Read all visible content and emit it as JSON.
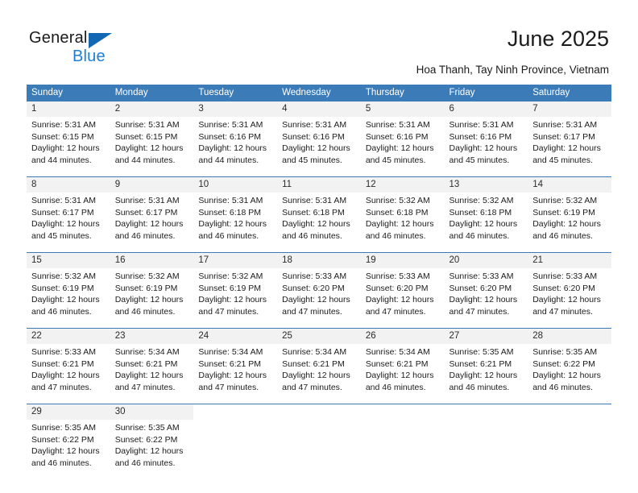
{
  "brand": {
    "name_part1": "General",
    "name_part2": "Blue",
    "color_dark": "#1b1b1b",
    "color_blue": "#1c7fd4",
    "triangle_color": "#1268b3"
  },
  "header": {
    "title": "June 2025",
    "subtitle": "Hoa Thanh, Tay Ninh Province, Vietnam"
  },
  "theme": {
    "header_row_bg": "#3b7cb8",
    "header_row_text": "#ffffff",
    "daynum_bg": "#f2f2f2",
    "separator_color": "#3b7cb8",
    "body_text": "#1b1b1b"
  },
  "calendar": {
    "weekday_headers": [
      "Sunday",
      "Monday",
      "Tuesday",
      "Wednesday",
      "Thursday",
      "Friday",
      "Saturday"
    ],
    "weeks": [
      {
        "days": [
          {
            "num": "1",
            "sunrise": "Sunrise: 5:31 AM",
            "sunset": "Sunset: 6:15 PM",
            "daylight": "Daylight: 12 hours and 44 minutes."
          },
          {
            "num": "2",
            "sunrise": "Sunrise: 5:31 AM",
            "sunset": "Sunset: 6:15 PM",
            "daylight": "Daylight: 12 hours and 44 minutes."
          },
          {
            "num": "3",
            "sunrise": "Sunrise: 5:31 AM",
            "sunset": "Sunset: 6:16 PM",
            "daylight": "Daylight: 12 hours and 44 minutes."
          },
          {
            "num": "4",
            "sunrise": "Sunrise: 5:31 AM",
            "sunset": "Sunset: 6:16 PM",
            "daylight": "Daylight: 12 hours and 45 minutes."
          },
          {
            "num": "5",
            "sunrise": "Sunrise: 5:31 AM",
            "sunset": "Sunset: 6:16 PM",
            "daylight": "Daylight: 12 hours and 45 minutes."
          },
          {
            "num": "6",
            "sunrise": "Sunrise: 5:31 AM",
            "sunset": "Sunset: 6:16 PM",
            "daylight": "Daylight: 12 hours and 45 minutes."
          },
          {
            "num": "7",
            "sunrise": "Sunrise: 5:31 AM",
            "sunset": "Sunset: 6:17 PM",
            "daylight": "Daylight: 12 hours and 45 minutes."
          }
        ]
      },
      {
        "days": [
          {
            "num": "8",
            "sunrise": "Sunrise: 5:31 AM",
            "sunset": "Sunset: 6:17 PM",
            "daylight": "Daylight: 12 hours and 45 minutes."
          },
          {
            "num": "9",
            "sunrise": "Sunrise: 5:31 AM",
            "sunset": "Sunset: 6:17 PM",
            "daylight": "Daylight: 12 hours and 46 minutes."
          },
          {
            "num": "10",
            "sunrise": "Sunrise: 5:31 AM",
            "sunset": "Sunset: 6:18 PM",
            "daylight": "Daylight: 12 hours and 46 minutes."
          },
          {
            "num": "11",
            "sunrise": "Sunrise: 5:31 AM",
            "sunset": "Sunset: 6:18 PM",
            "daylight": "Daylight: 12 hours and 46 minutes."
          },
          {
            "num": "12",
            "sunrise": "Sunrise: 5:32 AM",
            "sunset": "Sunset: 6:18 PM",
            "daylight": "Daylight: 12 hours and 46 minutes."
          },
          {
            "num": "13",
            "sunrise": "Sunrise: 5:32 AM",
            "sunset": "Sunset: 6:18 PM",
            "daylight": "Daylight: 12 hours and 46 minutes."
          },
          {
            "num": "14",
            "sunrise": "Sunrise: 5:32 AM",
            "sunset": "Sunset: 6:19 PM",
            "daylight": "Daylight: 12 hours and 46 minutes."
          }
        ]
      },
      {
        "days": [
          {
            "num": "15",
            "sunrise": "Sunrise: 5:32 AM",
            "sunset": "Sunset: 6:19 PM",
            "daylight": "Daylight: 12 hours and 46 minutes."
          },
          {
            "num": "16",
            "sunrise": "Sunrise: 5:32 AM",
            "sunset": "Sunset: 6:19 PM",
            "daylight": "Daylight: 12 hours and 46 minutes."
          },
          {
            "num": "17",
            "sunrise": "Sunrise: 5:32 AM",
            "sunset": "Sunset: 6:19 PM",
            "daylight": "Daylight: 12 hours and 47 minutes."
          },
          {
            "num": "18",
            "sunrise": "Sunrise: 5:33 AM",
            "sunset": "Sunset: 6:20 PM",
            "daylight": "Daylight: 12 hours and 47 minutes."
          },
          {
            "num": "19",
            "sunrise": "Sunrise: 5:33 AM",
            "sunset": "Sunset: 6:20 PM",
            "daylight": "Daylight: 12 hours and 47 minutes."
          },
          {
            "num": "20",
            "sunrise": "Sunrise: 5:33 AM",
            "sunset": "Sunset: 6:20 PM",
            "daylight": "Daylight: 12 hours and 47 minutes."
          },
          {
            "num": "21",
            "sunrise": "Sunrise: 5:33 AM",
            "sunset": "Sunset: 6:20 PM",
            "daylight": "Daylight: 12 hours and 47 minutes."
          }
        ]
      },
      {
        "days": [
          {
            "num": "22",
            "sunrise": "Sunrise: 5:33 AM",
            "sunset": "Sunset: 6:21 PM",
            "daylight": "Daylight: 12 hours and 47 minutes."
          },
          {
            "num": "23",
            "sunrise": "Sunrise: 5:34 AM",
            "sunset": "Sunset: 6:21 PM",
            "daylight": "Daylight: 12 hours and 47 minutes."
          },
          {
            "num": "24",
            "sunrise": "Sunrise: 5:34 AM",
            "sunset": "Sunset: 6:21 PM",
            "daylight": "Daylight: 12 hours and 47 minutes."
          },
          {
            "num": "25",
            "sunrise": "Sunrise: 5:34 AM",
            "sunset": "Sunset: 6:21 PM",
            "daylight": "Daylight: 12 hours and 47 minutes."
          },
          {
            "num": "26",
            "sunrise": "Sunrise: 5:34 AM",
            "sunset": "Sunset: 6:21 PM",
            "daylight": "Daylight: 12 hours and 46 minutes."
          },
          {
            "num": "27",
            "sunrise": "Sunrise: 5:35 AM",
            "sunset": "Sunset: 6:21 PM",
            "daylight": "Daylight: 12 hours and 46 minutes."
          },
          {
            "num": "28",
            "sunrise": "Sunrise: 5:35 AM",
            "sunset": "Sunset: 6:22 PM",
            "daylight": "Daylight: 12 hours and 46 minutes."
          }
        ]
      },
      {
        "days": [
          {
            "num": "29",
            "sunrise": "Sunrise: 5:35 AM",
            "sunset": "Sunset: 6:22 PM",
            "daylight": "Daylight: 12 hours and 46 minutes."
          },
          {
            "num": "30",
            "sunrise": "Sunrise: 5:35 AM",
            "sunset": "Sunset: 6:22 PM",
            "daylight": "Daylight: 12 hours and 46 minutes."
          },
          {
            "num": "",
            "sunrise": "",
            "sunset": "",
            "daylight": ""
          },
          {
            "num": "",
            "sunrise": "",
            "sunset": "",
            "daylight": ""
          },
          {
            "num": "",
            "sunrise": "",
            "sunset": "",
            "daylight": ""
          },
          {
            "num": "",
            "sunrise": "",
            "sunset": "",
            "daylight": ""
          },
          {
            "num": "",
            "sunrise": "",
            "sunset": "",
            "daylight": ""
          }
        ]
      }
    ]
  }
}
